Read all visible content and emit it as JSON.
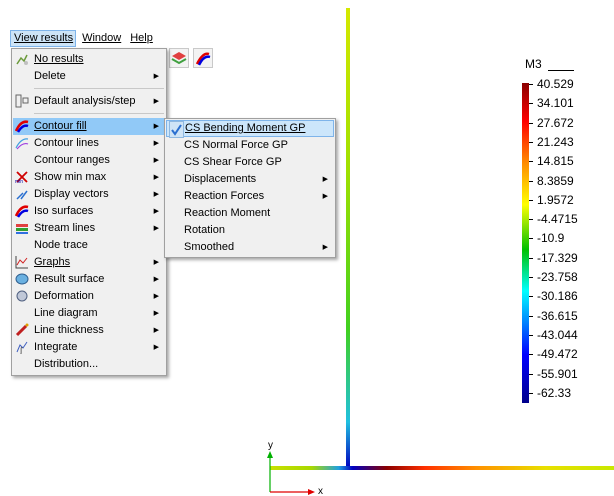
{
  "menubar": {
    "items": [
      {
        "label": "View results",
        "active": true
      },
      {
        "label": "Window",
        "active": false
      },
      {
        "label": "Help",
        "active": false
      }
    ]
  },
  "main_menu": {
    "items": [
      {
        "label": "No results",
        "icon": "no-results-icon",
        "submenu": false
      },
      {
        "label": "Delete",
        "icon": "",
        "submenu": true
      },
      {
        "label": "Default analysis/step",
        "icon": "analysis-step-icon",
        "submenu": true
      },
      {
        "label": "Contour fill",
        "icon": "contour-fill-icon",
        "submenu": true,
        "highlighted": true
      },
      {
        "label": "Contour lines",
        "icon": "contour-lines-icon",
        "submenu": true
      },
      {
        "label": "Contour ranges",
        "icon": "",
        "submenu": true
      },
      {
        "label": "Show min max",
        "icon": "min-max-icon",
        "submenu": true
      },
      {
        "label": "Display vectors",
        "icon": "vectors-icon",
        "submenu": true
      },
      {
        "label": "Iso surfaces",
        "icon": "iso-surfaces-icon",
        "submenu": true
      },
      {
        "label": "Stream lines",
        "icon": "stream-lines-icon",
        "submenu": true
      },
      {
        "label": "Node trace",
        "icon": "",
        "submenu": false
      },
      {
        "label": "Graphs",
        "icon": "graphs-icon",
        "submenu": true
      },
      {
        "label": "Result surface",
        "icon": "result-surface-icon",
        "submenu": true
      },
      {
        "label": "Deformation",
        "icon": "deformation-icon",
        "submenu": true
      },
      {
        "label": "Line diagram",
        "icon": "",
        "submenu": true
      },
      {
        "label": "Line thickness",
        "icon": "line-thickness-icon",
        "submenu": true
      },
      {
        "label": "Integrate",
        "icon": "integrate-icon",
        "submenu": true
      },
      {
        "label": "Distribution...",
        "icon": "",
        "submenu": false
      }
    ]
  },
  "sub_menu": {
    "items": [
      {
        "label": "CS Bending Moment GP",
        "submenu": false,
        "checked": true
      },
      {
        "label": "CS Normal Force GP",
        "submenu": false
      },
      {
        "label": "CS Shear Force GP",
        "submenu": false
      },
      {
        "label": "Displacements",
        "submenu": true
      },
      {
        "label": "Reaction Forces",
        "submenu": true
      },
      {
        "label": "Reaction Moment",
        "submenu": false
      },
      {
        "label": "Rotation",
        "submenu": false
      },
      {
        "label": "Smoothed",
        "submenu": true
      }
    ]
  },
  "legend": {
    "title": "M3",
    "values": [
      "40.529",
      "34.101",
      "27.672",
      "21.243",
      "14.815",
      "8.3859",
      "1.9572",
      "-4.4715",
      "-10.9",
      "-17.329",
      "-23.758",
      "-30.186",
      "-36.615",
      "-43.044",
      "-49.472",
      "-55.901",
      "-62.33"
    ],
    "colors": [
      "#8b0000",
      "#ff0000",
      "#ff8c00",
      "#ffff00",
      "#00c000",
      "#00ffff",
      "#0000ff",
      "#00008b"
    ]
  },
  "axes": {
    "x_label": "x",
    "y_label": "y"
  }
}
